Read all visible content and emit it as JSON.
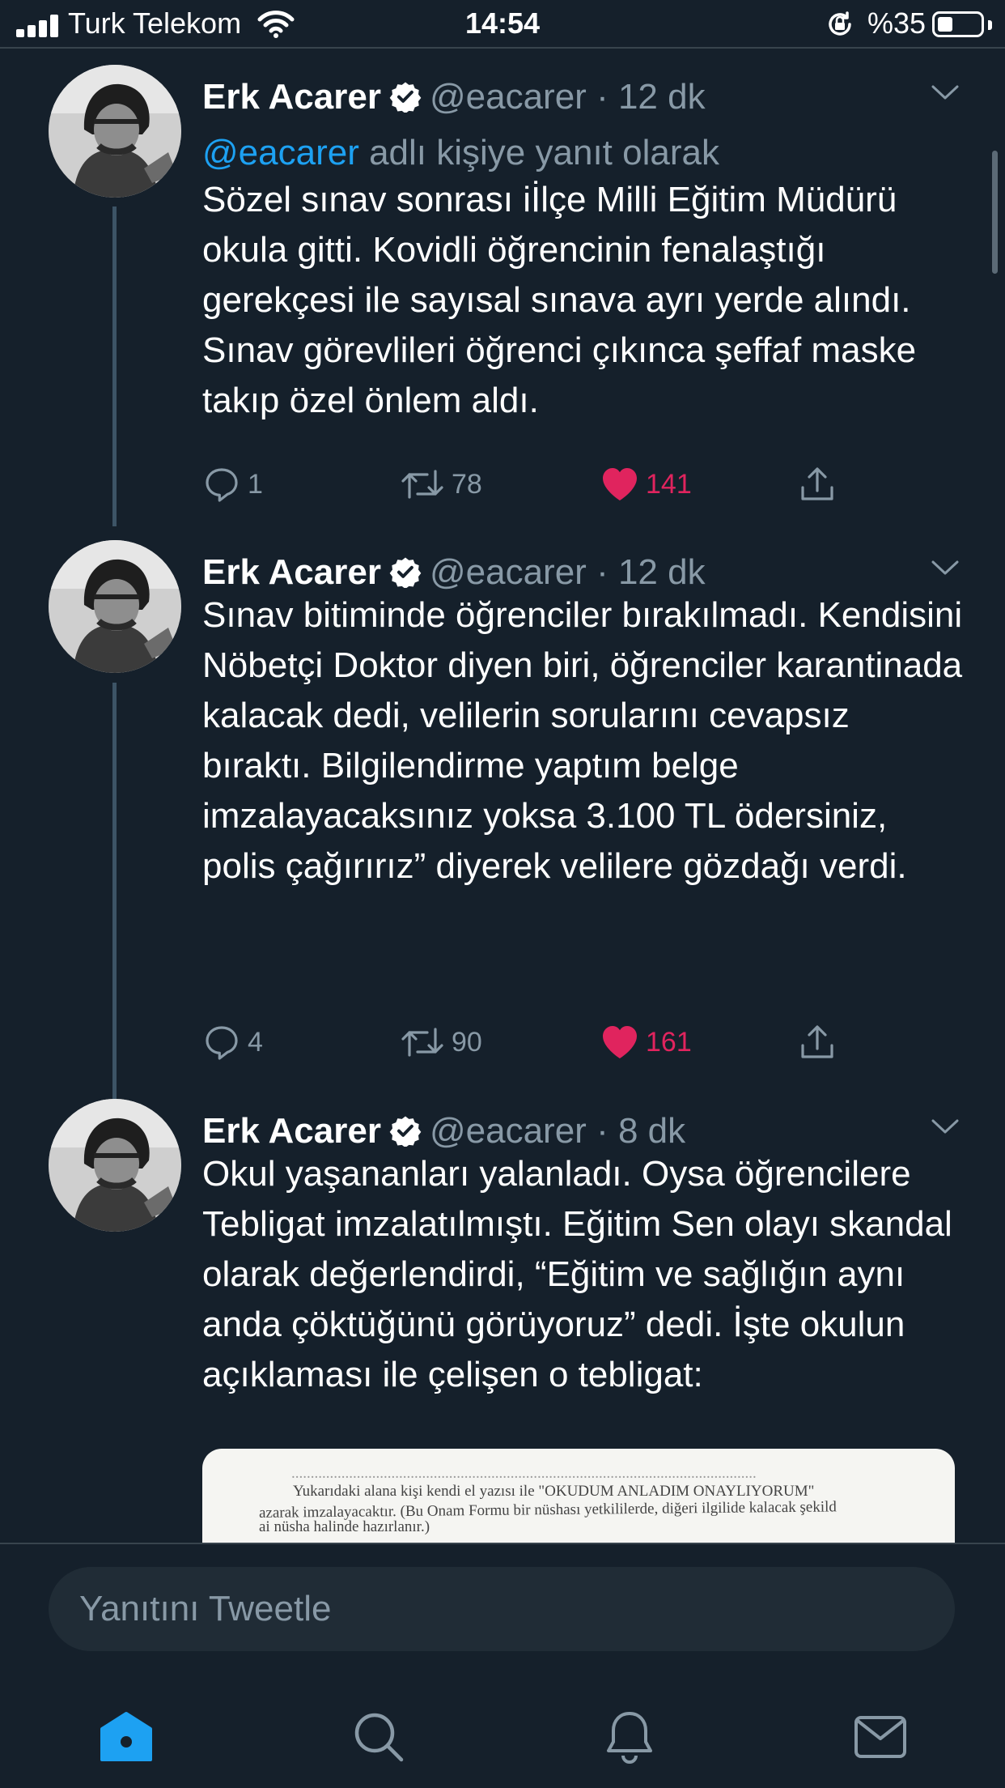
{
  "status_bar": {
    "carrier": "Turk Telekom",
    "time": "14:54",
    "battery": "%35",
    "battery_level": 0.35
  },
  "tweets": [
    {
      "name": "Erk Acarer",
      "handle": "@eacarer",
      "separator": "·",
      "time": "12 dk",
      "reply_mention": "@eacarer",
      "reply_rest": " adlı kişiye yanıt olarak",
      "text": "Sözel sınav sonrası iİlçe Milli Eğitim Müdürü okula gitti. Kovidli öğrencinin fenalaştığı gerekçesi ile sayısal sınava ayrı yerde alındı. Sınav görevlileri öğrenci çıkınca şeffaf maske takıp özel önlem aldı.",
      "replies": "1",
      "retweets": "78",
      "likes": "141"
    },
    {
      "name": "Erk Acarer",
      "handle": "@eacarer",
      "separator": "·",
      "time": "12 dk",
      "text": "Sınav bitiminde öğrenciler bırakılmadı. Kendisini Nöbetçi Doktor diyen biri, öğrenciler karantinada kalacak dedi, velilerin sorularını cevapsız bıraktı. Bilgilendirme yaptım belge imzalayacaksınız yoksa 3.100 TL ödersiniz, polis çağırırız” diyerek velilere gözdağı verdi.",
      "replies": "4",
      "retweets": "90",
      "likes": "161"
    },
    {
      "name": "Erk Acarer",
      "handle": "@eacarer",
      "separator": "·",
      "time": "8 dk",
      "text": "Okul yaşananları yalanladı. Oysa öğrencilere Tebligat imzalatılmıştı. Eğitim Sen olayı skandal olarak değerlendirdi, “Eğitim ve sağlığın aynı anda çöktüğünü görüyoruz” dedi. İşte okulun açıklaması ile çelişen o tebligat:",
      "media_lines": [
        "Yukarıdaki alana kişi kendi el yazısı ile \"OKUDUM ANLADIM ONAYLIYORUM\"",
        "azarak imzalayacaktır. (Bu Onam Formu bir nüshası yetkililerde, diğeri ilgilide kalacak şekild",
        "ai nüsha halinde hazırlanır.)"
      ]
    }
  ],
  "reply_bar": {
    "placeholder": "Yanıtını Tweetle"
  },
  "tab_bar": {
    "items": [
      {
        "icon": "home-icon",
        "active": true
      },
      {
        "icon": "search-icon",
        "active": false
      },
      {
        "icon": "bell-icon",
        "active": false
      },
      {
        "icon": "mail-icon",
        "active": false
      }
    ]
  },
  "colors": {
    "background": "#15202b",
    "accent": "#1da1f2",
    "like": "#e0245e",
    "secondary_text": "#8899a6"
  }
}
